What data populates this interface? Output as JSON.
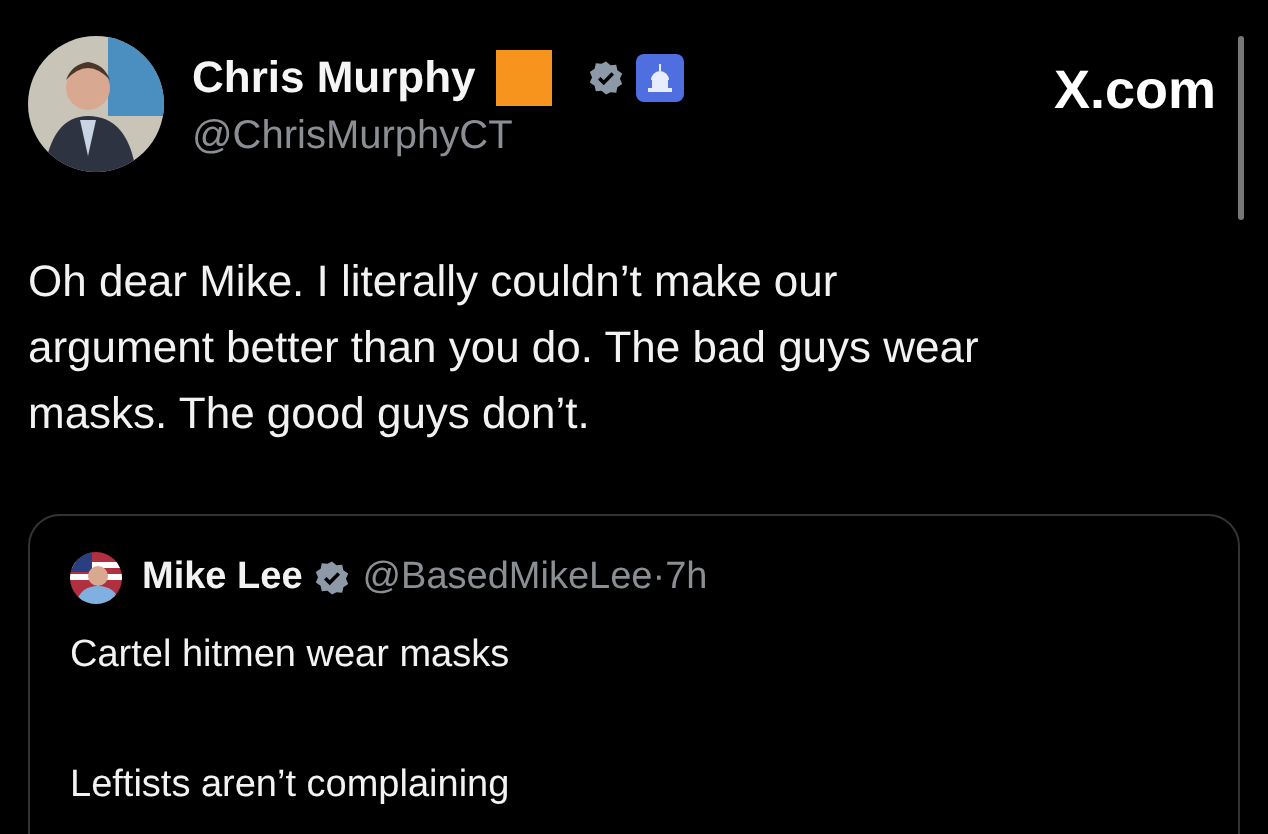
{
  "post": {
    "author": {
      "name": "Chris Murphy",
      "handle": "@ChrisMurphyCT"
    },
    "site_logo": "X.com",
    "text": "Oh dear Mike. I literally couldn’t make our argument better than you do. The bad guys wear masks. The good guys don’t.",
    "quoted_post": {
      "author": {
        "name": "Mike Lee",
        "handle": "@BasedMikeLee",
        "time": "·7h"
      },
      "paragraphs": [
        "Cartel hitmen wear masks",
        "Leftists aren’t complaining"
      ]
    }
  }
}
